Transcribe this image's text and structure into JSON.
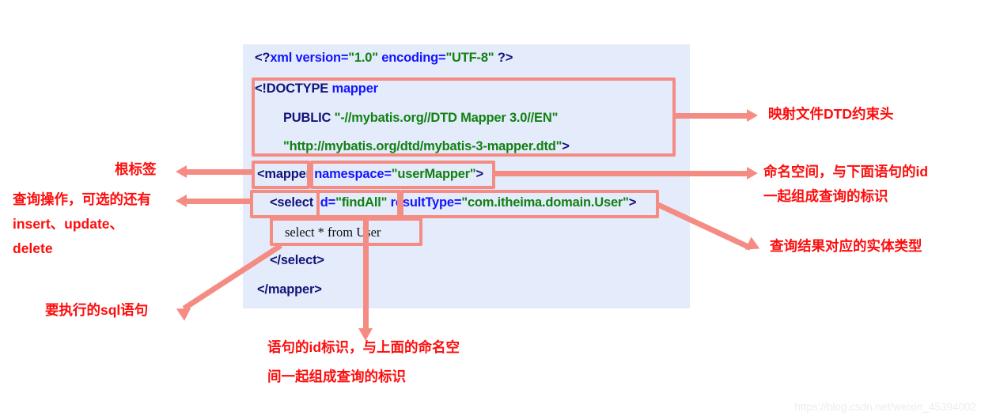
{
  "code_block": {
    "background_color": "#e4ecfb",
    "lines": [
      {
        "id": "xml_decl",
        "parts": [
          {
            "t": "<?",
            "c": "dark"
          },
          {
            "t": "xml version=",
            "c": "name"
          },
          {
            "t": "\"1.0\"",
            "c": "str"
          },
          {
            "t": " encoding=",
            "c": "name"
          },
          {
            "t": "\"UTF-8\"",
            "c": "str"
          },
          {
            "t": " ?>",
            "c": "dark"
          }
        ]
      },
      {
        "id": "doctype",
        "parts": [
          {
            "t": "<!DOCTYPE ",
            "c": "dark"
          },
          {
            "t": "mapper",
            "c": "name"
          }
        ]
      },
      {
        "id": "public_id",
        "parts": [
          {
            "t": "PUBLIC ",
            "c": "dark"
          },
          {
            "t": "\"-//mybatis.org//DTD Mapper 3.0//EN\"",
            "c": "str"
          }
        ]
      },
      {
        "id": "system_id",
        "parts": [
          {
            "t": "\"http://mybatis.org/dtd/mybatis-3-mapper.dtd\"",
            "c": "str"
          },
          {
            "t": ">",
            "c": "dark"
          }
        ]
      },
      {
        "id": "mapper_open",
        "parts": [
          {
            "t": "<mapper ",
            "c": "dark"
          },
          {
            "t": "namespace=",
            "c": "name"
          },
          {
            "t": "\"userMapper\"",
            "c": "str"
          },
          {
            "t": ">",
            "c": "dark"
          }
        ]
      },
      {
        "id": "select_open",
        "parts": [
          {
            "t": "<select ",
            "c": "dark"
          },
          {
            "t": "id=",
            "c": "name"
          },
          {
            "t": "\"findAll\"",
            "c": "str"
          },
          {
            "t": " resultType=",
            "c": "name"
          },
          {
            "t": "\"com.itheima.domain.User\"",
            "c": "str"
          },
          {
            "t": ">",
            "c": "dark"
          }
        ]
      },
      {
        "id": "sql_body",
        "sql": "select * from User"
      },
      {
        "id": "select_close",
        "parts": [
          {
            "t": "</select>",
            "c": "dark"
          }
        ]
      },
      {
        "id": "mapper_close",
        "parts": [
          {
            "t": "</mapper>",
            "c": "dark"
          }
        ]
      }
    ]
  },
  "annotations": {
    "accent_color": "#f58c84",
    "text_color": "#fd0d0d",
    "dtd_header": "映射文件DTD约束头",
    "namespace_line1": "命名空间，与下面语句的id",
    "namespace_line2": "一起组成查询的标识",
    "result_type": "查询结果对应的实体类型",
    "root_tag": "根标签",
    "query_op_line1": "查询操作，可选的还有",
    "query_op_line2": "insert、update、",
    "query_op_line3": "delete",
    "sql_statement": "要执行的sql语句",
    "id_note_line1": "语句的id标识，与上面的命名空",
    "id_note_line2": "间一起组成查询的标识"
  },
  "watermark": {
    "text": "https://blog.csdn.net/weixin_45394002"
  }
}
